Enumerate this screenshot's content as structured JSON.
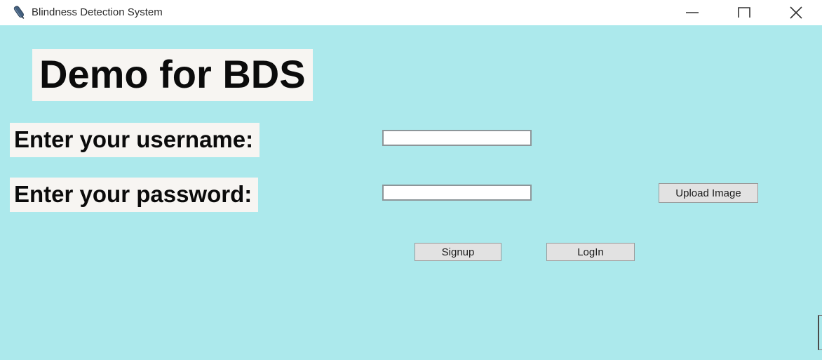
{
  "window": {
    "title": "Blindness Detection System",
    "icon": "feather-icon",
    "background_color": "#ace9ec",
    "titlebar_color": "#ffffff",
    "controls": [
      {
        "name": "minimize",
        "glyph": "minimize-icon"
      },
      {
        "name": "maximize",
        "glyph": "maximize-icon"
      },
      {
        "name": "close",
        "glyph": "close-icon"
      }
    ]
  },
  "main": {
    "heading": "Demo for BDS",
    "label_background": "#f7f5f2",
    "fields": [
      {
        "label": "Enter your username:",
        "value": "",
        "placeholder": ""
      },
      {
        "label": "Enter your password:",
        "value": "",
        "placeholder": ""
      }
    ],
    "buttons": {
      "upload": "Upload Image",
      "signup": "Signup",
      "login": "LogIn"
    }
  }
}
